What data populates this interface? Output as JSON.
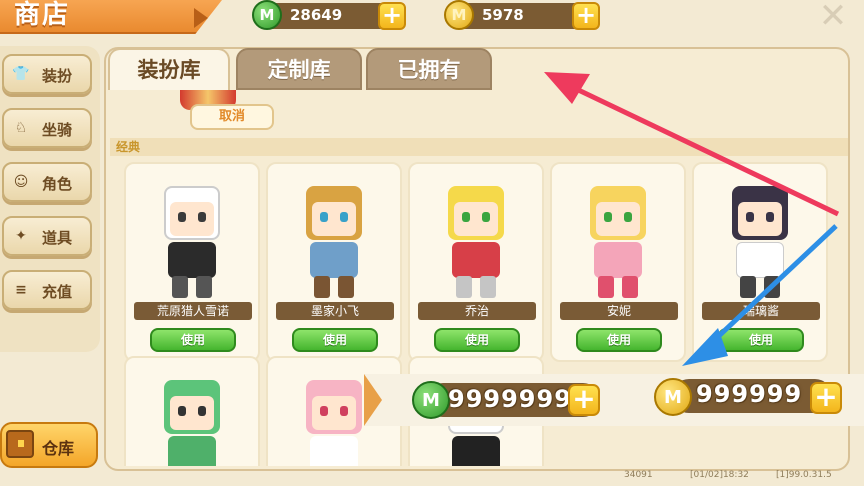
{
  "header": {
    "title": "商店",
    "mini_coin_green_amount": "28649",
    "mini_coin_gold_amount": "5978",
    "coin_symbol": "M",
    "plus_symbol": "+",
    "close_symbol": "✕"
  },
  "sidebar": {
    "items": [
      {
        "label": "装扮",
        "icon": "shirt-icon",
        "glyph": "👕"
      },
      {
        "label": "坐骑",
        "icon": "mount-icon",
        "glyph": "♘"
      },
      {
        "label": "角色",
        "icon": "character-icon",
        "glyph": "☺"
      },
      {
        "label": "道具",
        "icon": "item-icon",
        "glyph": "✦"
      },
      {
        "label": "充值",
        "icon": "recharge-icon",
        "glyph": "≡"
      }
    ],
    "warehouse_label": "仓库"
  },
  "tabs": [
    {
      "label": "装扮库",
      "active": true
    },
    {
      "label": "定制库",
      "active": false
    },
    {
      "label": "已拥有",
      "active": false
    }
  ],
  "content": {
    "cancel_label": "取消",
    "section_label": "经典",
    "use_label": "使用",
    "cards": [
      {
        "name": "荒原猎人雪诺",
        "hair": "#ffffff",
        "outfit": "#2b2b2b",
        "eye": "#3b3b3b"
      },
      {
        "name": "墨家小飞",
        "hair": "#d9a342",
        "outfit": "#6f9fc9",
        "eye": "#38a1c9"
      },
      {
        "name": "乔治",
        "hair": "#f5d94a",
        "outfit": "#d73f48",
        "eye": "#3aa540"
      },
      {
        "name": "安妮",
        "hair": "#f7d45e",
        "outfit": "#f4a5b9",
        "eye": "#3aa540"
      },
      {
        "name": "瑞璃酱",
        "hair": "#3a3346",
        "outfit": "#ffffff",
        "eye": "#3a3346"
      }
    ],
    "second_row": [
      {
        "hair": "#5cc47a",
        "outfit": "#4fb06a"
      },
      {
        "hair": "#f7b4c4",
        "outfit": "#ffffff"
      },
      {
        "hair": "#ffffff",
        "outfit": "#222222"
      }
    ]
  },
  "overlay": {
    "green_amount": "99999999",
    "gold_amount": "999999",
    "plus_symbol": "+",
    "coin_symbol": "M"
  },
  "footer": {
    "id": "34091",
    "time": "[01/02]18:32",
    "version": "[1]99.0.31.5"
  },
  "annotations": {
    "arrow_red_color": "#ee3a5d",
    "arrow_blue_color": "#2d8fe6"
  }
}
